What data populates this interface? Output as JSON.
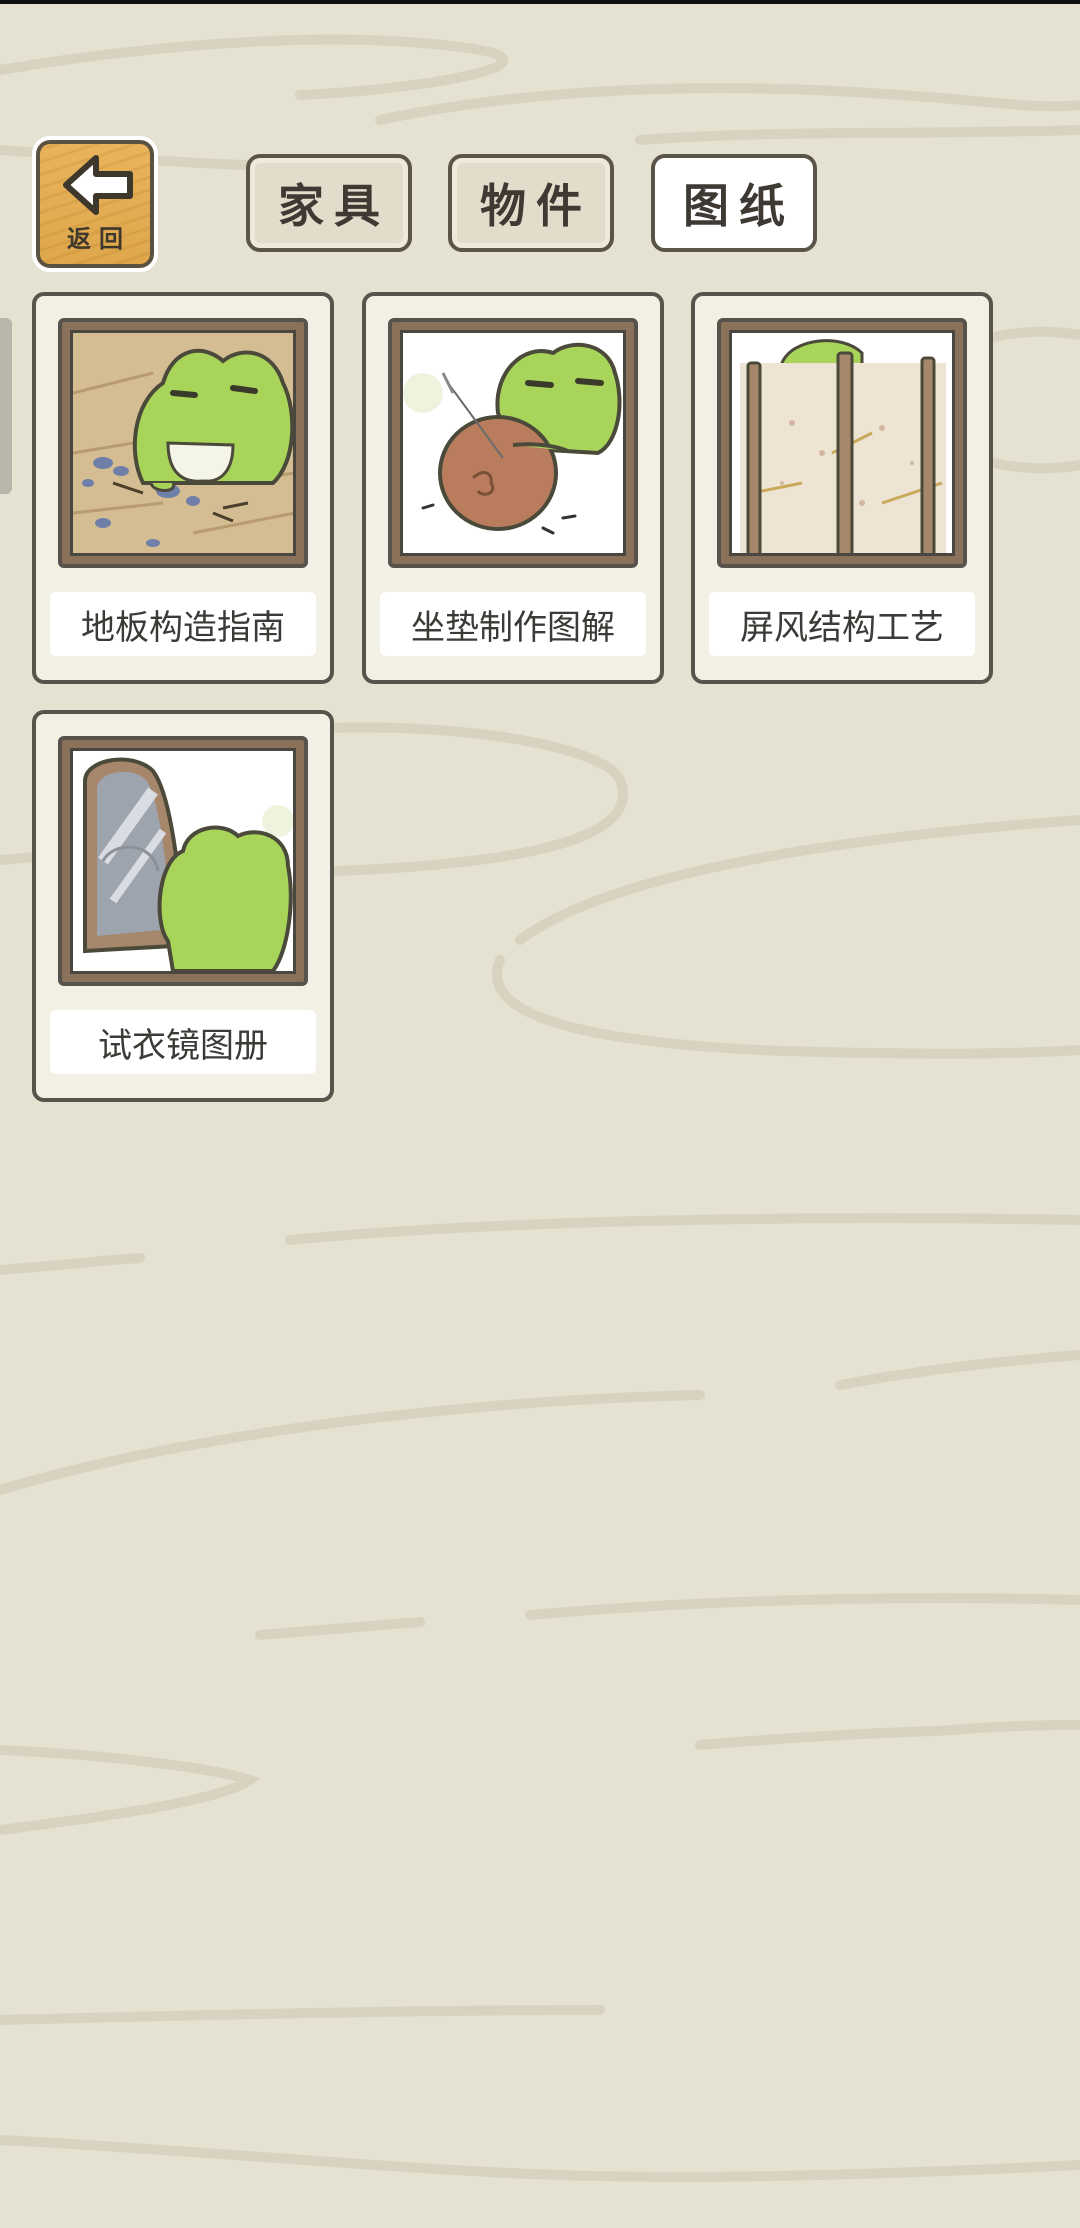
{
  "back_button": {
    "label": "返回",
    "icon": "arrow-left-icon"
  },
  "tabs": [
    {
      "label": "家具",
      "active": false
    },
    {
      "label": "物件",
      "active": false
    },
    {
      "label": "图纸",
      "active": true
    }
  ],
  "items": [
    {
      "name": "地板构造指南",
      "icon": "floor-frog-illustration"
    },
    {
      "name": "坐垫制作图解",
      "icon": "cushion-frog-illustration"
    },
    {
      "name": "屏风结构工艺",
      "icon": "screen-frog-illustration"
    },
    {
      "name": "试衣镜图册",
      "icon": "mirror-frog-illustration"
    }
  ],
  "colors": {
    "background": "#e6e2d1",
    "frog_green": "#a8d45a",
    "back_button_wood": "#e2aa50",
    "card_border": "#58544c"
  }
}
